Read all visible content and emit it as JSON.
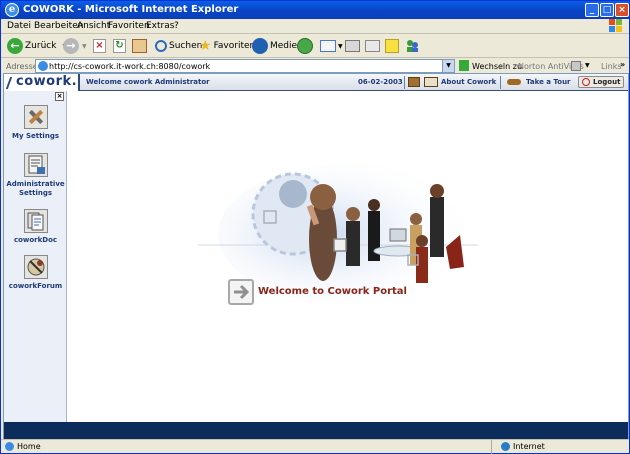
{
  "window": {
    "title": "COWORK - Microsoft Internet Explorer"
  },
  "menu": [
    "Datei",
    "Bearbeiten",
    "Ansicht",
    "Favoriten",
    "Extras",
    "?"
  ],
  "toolbar": {
    "back_label": "Zurück",
    "search_label": "Suchen",
    "favorites_label": "Favoriten",
    "media_label": "Medien"
  },
  "address": {
    "label": "Adresse",
    "url": "http://cs-cowork.it-work.ch:8080/cowork",
    "go_label": "Wechseln zu",
    "norton_label": "Norton AntiVirus",
    "links_label": "Links"
  },
  "app": {
    "logo": "cowork.",
    "welcome_text": "Welcome  cowork  Administrator",
    "date": "06-02-2003",
    "about_label": "About Cowork",
    "tour_label": "Take a Tour",
    "logout_label": "Logout",
    "close_symbol": "×",
    "welcome_banner": "Welcome to Cowork Portal"
  },
  "sidebar": {
    "items": [
      {
        "label": "My Settings",
        "icon": "tools-icon"
      },
      {
        "label": "Administrative Settings",
        "icon": "admin-document-icon"
      },
      {
        "label": "coworkDoc",
        "icon": "documents-icon"
      },
      {
        "label": "coworkForum",
        "icon": "forum-icon"
      }
    ]
  },
  "status": {
    "left": "Home",
    "zone": "Internet"
  }
}
